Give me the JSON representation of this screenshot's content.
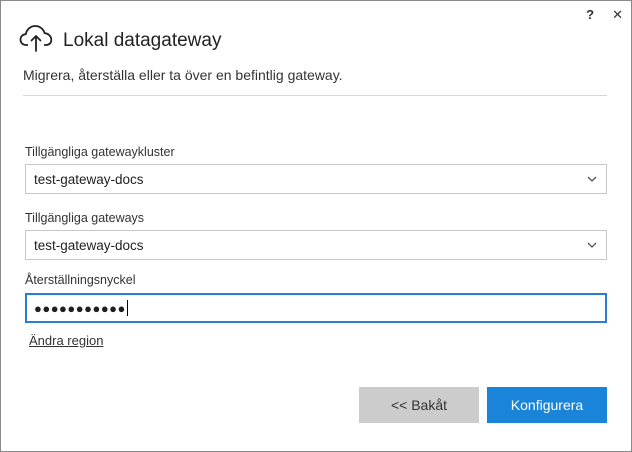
{
  "titlebar": {
    "help_label": "?",
    "close_label": "✕"
  },
  "header": {
    "icon": "cloud-upload-icon",
    "title": "Lokal datagateway",
    "subtitle": "Migrera, återställa eller ta över en befintlig gateway."
  },
  "form": {
    "cluster_label": "Tillgängliga gatewaykluster",
    "cluster_value": "test-gateway-docs",
    "gateway_label": "Tillgängliga gateways",
    "gateway_value": "test-gateway-docs",
    "recovery_label": "Återställningsnyckel",
    "recovery_value": "●●●●●●●●●●●",
    "change_region_label": "Ändra region"
  },
  "buttons": {
    "back_label": "<< Bakåt",
    "configure_label": "Konfigurera"
  },
  "colors": {
    "accent": "#1a84d8",
    "focus_border": "#2b7cd3",
    "secondary_button": "#cccccc"
  }
}
